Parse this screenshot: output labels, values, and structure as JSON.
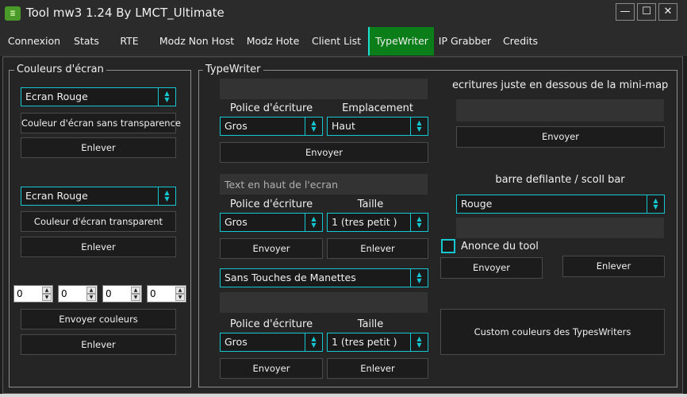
{
  "window": {
    "title": "Tool mw3 1.24 By LMCT_Ultimate",
    "icon_glyph": "≡",
    "minimize": "—",
    "maximize": "☐",
    "close": "✕"
  },
  "tabs": [
    {
      "label": "Connexion"
    },
    {
      "label": "Stats"
    },
    {
      "label": "RTE"
    },
    {
      "label": "Modz Non Host"
    },
    {
      "label": "Modz Hote"
    },
    {
      "label": "Client List"
    },
    {
      "label": "TypeWriter"
    },
    {
      "label": "IP Grabber"
    },
    {
      "label": "Credits"
    }
  ],
  "active_tab": "TypeWriter",
  "colors": {
    "accent": "#16c7d1",
    "active_tab": "#0b7d19",
    "background": "#1e1e1e"
  },
  "screen_colors": {
    "legend": "Couleurs d'écran",
    "combo1": "Ecran Rouge",
    "btn_opaque": "Couleur d'écran sans transparence",
    "remove1": "Enlever",
    "combo2": "Ecran Rouge",
    "btn_transparent": "Couleur d'écran transparent",
    "remove2": "Enlever",
    "spinners": [
      "0",
      "0",
      "0",
      "0"
    ],
    "send_colors": "Envoyer couleurs",
    "remove3": "Enlever"
  },
  "typewriter": {
    "legend": "TypeWriter",
    "block1": {
      "font_label": "Police d'écriture",
      "pos_label": "Emplacement",
      "font_value": "Gros",
      "pos_value": "Haut",
      "send": "Envoyer"
    },
    "block2": {
      "placeholder": "Text en haut de l'ecran",
      "font_label": "Police d'écriture",
      "size_label": "Taille",
      "font_value": "Gros",
      "size_value": "1 (tres petit )",
      "send": "Envoyer",
      "remove": "Enlever"
    },
    "block3": {
      "buttons_value": "Sans Touches de Manettes",
      "font_label": "Police d'écriture",
      "size_label": "Taille",
      "font_value": "Gros",
      "size_value": "1 (tres petit )",
      "send": "Envoyer",
      "remove": "Enlever"
    }
  },
  "right": {
    "minimap_label": "ecritures juste en dessous de la mini-map",
    "minimap_send": "Envoyer",
    "scroll_label": "barre defilante / scoll bar",
    "scroll_value": "Rouge",
    "announce_label": "Anonce du tool",
    "announce_send": "Envoyer",
    "announce_remove": "Enlever",
    "custom_colors": "Custom couleurs des TypesWriters"
  },
  "arrows": {
    "up": "▲",
    "down": "▼"
  }
}
